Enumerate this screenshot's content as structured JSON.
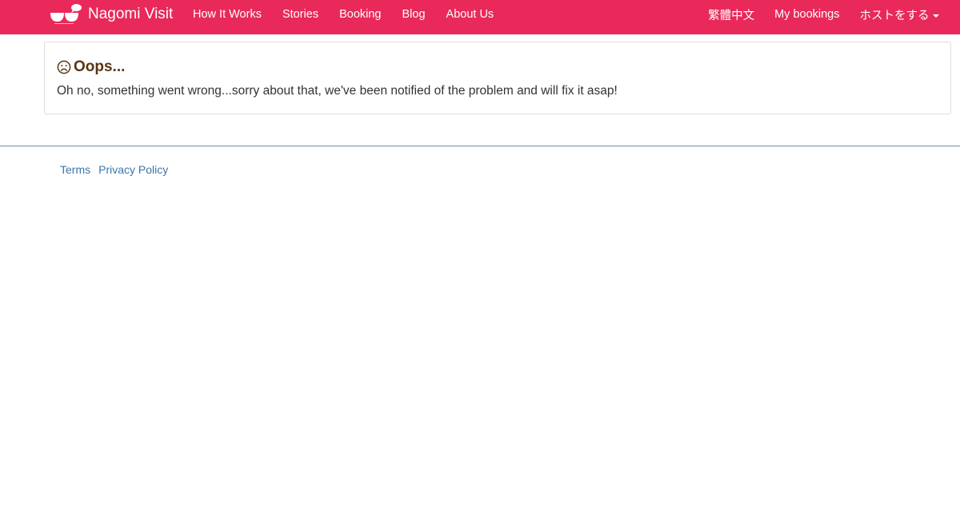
{
  "navbar": {
    "brand": "Nagomi Visit",
    "links": [
      "How It Works",
      "Stories",
      "Booking",
      "Blog",
      "About Us"
    ],
    "right_links": {
      "language": "繁體中文",
      "my_bookings": "My bookings",
      "host": "ホストをする"
    },
    "background_color": "#e8295a"
  },
  "error": {
    "title": "Oops...",
    "message": "Oh no, something went wrong...sorry about that, we've been notified of the problem and will fix it asap!",
    "icon": "frown-icon"
  },
  "footer": {
    "links": [
      "Terms",
      "Privacy Policy"
    ]
  }
}
